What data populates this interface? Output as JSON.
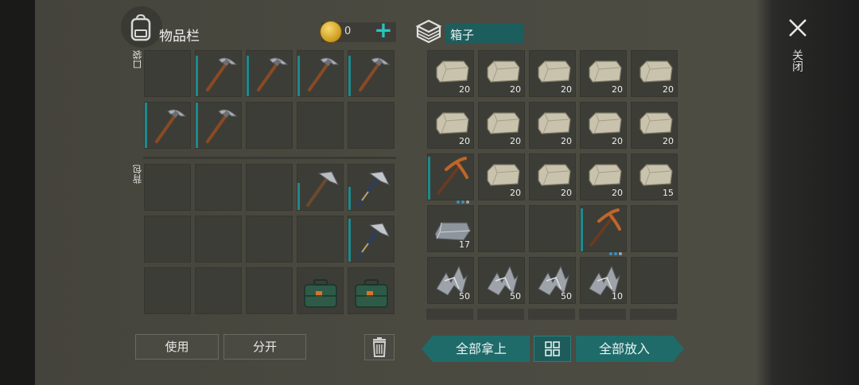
{
  "inventory": {
    "title": "物品栏",
    "coins": "0",
    "plus_icon": "plus-icon",
    "pocket_label": "口袋",
    "backpack_label": "背包",
    "pocket_slots": [
      {
        "item": "empty"
      },
      {
        "item": "pickaxe",
        "bar": 0.9
      },
      {
        "item": "pickaxe",
        "bar": 0.9
      },
      {
        "item": "pickaxe",
        "bar": 0.9
      },
      {
        "item": "pickaxe",
        "bar": 0.9
      },
      {
        "item": "pickaxe",
        "bar": 1.0
      },
      {
        "item": "pickaxe",
        "bar": 1.0
      },
      {
        "item": "empty"
      },
      {
        "item": "empty"
      },
      {
        "item": "empty"
      }
    ],
    "backpack_slots": [
      {
        "item": "empty"
      },
      {
        "item": "empty"
      },
      {
        "item": "empty"
      },
      {
        "item": "hatchet",
        "bar": 0.6
      },
      {
        "item": "hatchet-blue",
        "bar": 0.5
      },
      {
        "item": "empty"
      },
      {
        "item": "empty"
      },
      {
        "item": "empty"
      },
      {
        "item": "empty"
      },
      {
        "item": "hatchet-blue",
        "bar": 0.95
      },
      {
        "item": "empty"
      },
      {
        "item": "empty"
      },
      {
        "item": "empty"
      },
      {
        "item": "case"
      },
      {
        "item": "case"
      }
    ]
  },
  "buttons": {
    "use": "使用",
    "split": "分开",
    "trash_icon": "trash-icon",
    "take_all": "全部拿上",
    "sort_icon": "grid-icon",
    "put_all": "全部放入"
  },
  "chest": {
    "name": "箱子",
    "icon": "chest-icon",
    "slots": [
      {
        "item": "stone",
        "count": "20"
      },
      {
        "item": "stone",
        "count": "20"
      },
      {
        "item": "stone",
        "count": "20"
      },
      {
        "item": "stone",
        "count": "20"
      },
      {
        "item": "stone",
        "count": "20"
      },
      {
        "item": "stone",
        "count": "20"
      },
      {
        "item": "stone",
        "count": "20"
      },
      {
        "item": "stone",
        "count": "20"
      },
      {
        "item": "stone",
        "count": "20"
      },
      {
        "item": "stone",
        "count": "20"
      },
      {
        "item": "rusty-pickaxe",
        "bar": 0.95,
        "dots": true
      },
      {
        "item": "stone",
        "count": "20"
      },
      {
        "item": "stone",
        "count": "20"
      },
      {
        "item": "stone",
        "count": "20"
      },
      {
        "item": "stone",
        "count": "15"
      },
      {
        "item": "iron-ingot",
        "count": "17"
      },
      {
        "item": "empty"
      },
      {
        "item": "empty"
      },
      {
        "item": "rusty-pickaxe",
        "bar": 0.95,
        "dots": true
      },
      {
        "item": "empty"
      },
      {
        "item": "scrap-metal",
        "count": "50"
      },
      {
        "item": "scrap-metal",
        "count": "50"
      },
      {
        "item": "scrap-metal",
        "count": "50"
      },
      {
        "item": "scrap-metal",
        "count": "10"
      },
      {
        "item": "empty"
      }
    ]
  },
  "close": {
    "label": "关闭",
    "icon": "close-icon"
  },
  "colors": {
    "accent": "#1f6b6a",
    "durability": "#1d8a8e",
    "slot": "#3d3d37"
  }
}
